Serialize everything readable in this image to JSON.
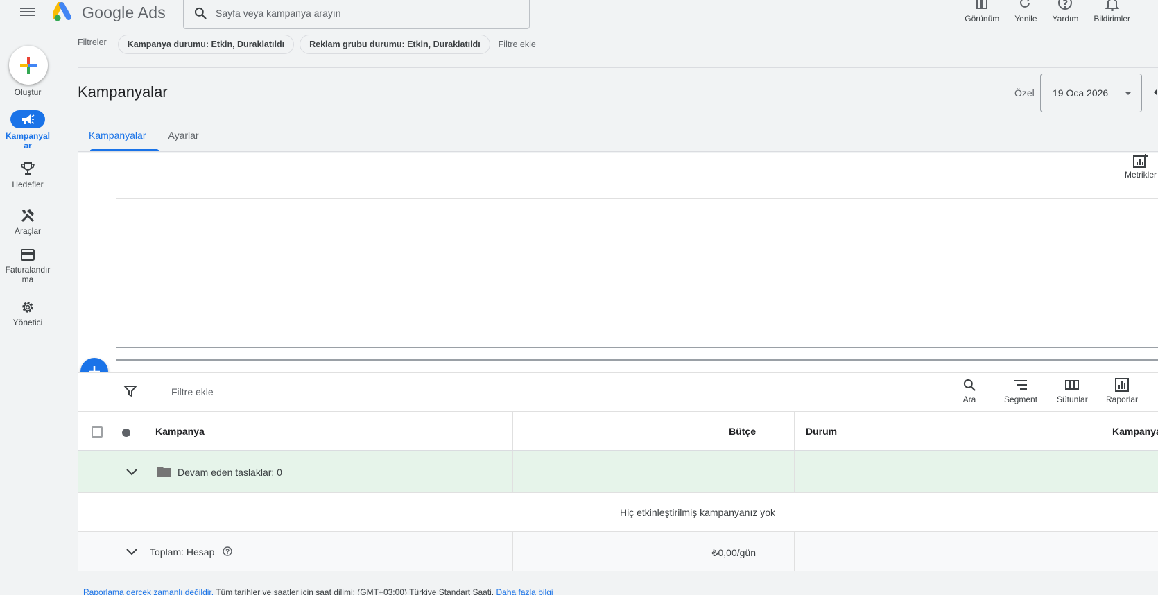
{
  "app": {
    "name": "Google Ads"
  },
  "search": {
    "placeholder": "Sayfa veya kampanya arayın"
  },
  "top_actions": [
    {
      "label": "Görünüm",
      "icon": "appearance-icon"
    },
    {
      "label": "Yenile",
      "icon": "refresh-icon"
    },
    {
      "label": "Yardım",
      "icon": "help-icon"
    },
    {
      "label": "Bildirimler",
      "icon": "bell-icon"
    }
  ],
  "filters": {
    "label": "Filtreler",
    "chips": [
      "Kampanya durumu: Etkin, Duraklatıldı",
      "Reklam grubu durumu: Etkin, Duraklatıldı"
    ],
    "add_label": "Filtre ekle"
  },
  "nav": {
    "create_label": "Oluştur",
    "items": [
      {
        "label": "Kampanyalar",
        "icon": "megaphone-icon",
        "active": true
      },
      {
        "label": "Hedefler",
        "icon": "trophy-icon"
      },
      {
        "label": "Araçlar",
        "icon": "tools-icon"
      },
      {
        "label": "Faturalandırma",
        "icon": "credit-card-icon"
      },
      {
        "label": "Yönetici",
        "icon": "gear-icon"
      }
    ]
  },
  "page": {
    "title": "Kampanyalar",
    "date_label": "Özel",
    "date_value": "19 Oca 2026"
  },
  "tabs": [
    {
      "label": "Kampanyalar",
      "active": true
    },
    {
      "label": "Ayarlar"
    }
  ],
  "chart": {
    "metrics_label": "Metrikler"
  },
  "toolbar": {
    "filter_add": "Filtre ekle",
    "actions": [
      {
        "label": "Ara",
        "icon": "search-icon"
      },
      {
        "label": "Segment",
        "icon": "segment-icon"
      },
      {
        "label": "Sütunlar",
        "icon": "columns-icon"
      },
      {
        "label": "Raporlar",
        "icon": "reports-icon"
      }
    ]
  },
  "table": {
    "headers": {
      "campaign": "Kampanya",
      "budget": "Bütçe",
      "status": "Durum",
      "campaign_type": "Kampanya"
    },
    "drafts_row": "Devam eden taslaklar: 0",
    "empty_message": "Hiç etkinleştirilmiş kampanyanız yok",
    "total_row": {
      "label": "Toplam: Hesap",
      "budget": "₺0,00/gün"
    }
  },
  "footer": {
    "link1": "Raporlama gerçek zamanlı değildir.",
    "text": " Tüm tarihler ve saatler için saat dilimi: (GMT+03:00) Türkiye Standart Saati. ",
    "link2": "Daha fazla bilgi"
  },
  "colors": {
    "primary": "#1a73e8",
    "draft_row_bg": "#e6f4ea",
    "page_bg": "#f1f3f4"
  }
}
